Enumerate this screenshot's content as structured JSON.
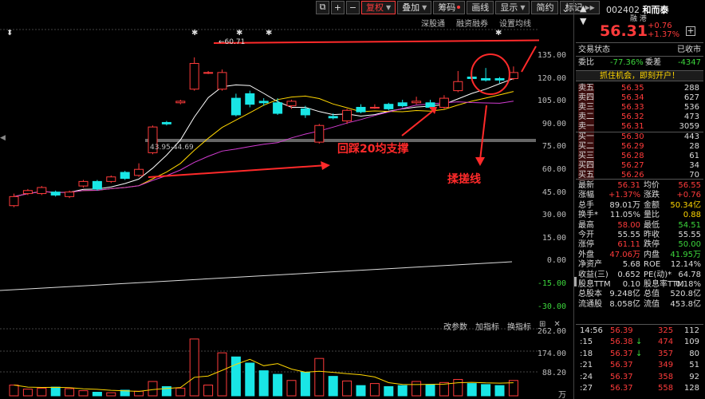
{
  "toolbar": {
    "fuquan": "复权",
    "diejia": "叠加",
    "chouma": "筹码",
    "huaxian": "画线",
    "xianshi": "显示",
    "jianyue": "简约",
    "jiliang": "标记"
  },
  "subtabs": [
    "深股通",
    "融资融券",
    "设置均线"
  ],
  "chart_data": {
    "type": "candlestick",
    "y_ticks": [
      "135.00",
      "120.00",
      "105.00",
      "90.00",
      "75.00",
      "60.00",
      "45.00",
      "30.00",
      "15.00",
      "0.00",
      "-15.00",
      "-30.00"
    ],
    "peak_label": "60.71",
    "range_label": "43.95-44.69",
    "candles": [
      {
        "o": 36,
        "c": 42,
        "h": 44,
        "l": 35
      },
      {
        "o": 44,
        "c": 46,
        "h": 47,
        "l": 43
      },
      {
        "o": 44,
        "c": 48,
        "h": 49,
        "l": 43
      },
      {
        "o": 45,
        "c": 43,
        "h": 46,
        "l": 42
      },
      {
        "o": 42,
        "c": 45,
        "h": 46,
        "l": 41
      },
      {
        "o": 49,
        "c": 52,
        "h": 53,
        "l": 48
      },
      {
        "o": 52,
        "c": 47,
        "h": 53,
        "l": 46
      },
      {
        "o": 52,
        "c": 55,
        "h": 56,
        "l": 51
      },
      {
        "o": 58,
        "c": 54,
        "h": 59,
        "l": 53
      },
      {
        "o": 56,
        "c": 60,
        "h": 64,
        "l": 55
      },
      {
        "o": 71,
        "c": 88,
        "h": 89,
        "l": 70
      },
      {
        "o": 91,
        "c": 90,
        "h": 92,
        "l": 89
      },
      {
        "o": 104,
        "c": 105,
        "h": 106,
        "l": 103
      },
      {
        "o": 113,
        "c": 130,
        "h": 134,
        "l": 112
      },
      {
        "o": 124,
        "c": 124,
        "h": 125,
        "l": 123
      },
      {
        "o": 113,
        "c": 124,
        "h": 126,
        "l": 112
      },
      {
        "o": 107,
        "c": 96,
        "h": 110,
        "l": 95
      },
      {
        "o": 110,
        "c": 103,
        "h": 112,
        "l": 101
      },
      {
        "o": 105,
        "c": 104,
        "h": 107,
        "l": 102
      },
      {
        "o": 104,
        "c": 97,
        "h": 107,
        "l": 96
      },
      {
        "o": 102,
        "c": 105,
        "h": 106,
        "l": 100
      },
      {
        "o": 100,
        "c": 96,
        "h": 102,
        "l": 94
      },
      {
        "o": 78,
        "c": 89,
        "h": 90,
        "l": 77
      },
      {
        "o": 95,
        "c": 94,
        "h": 97,
        "l": 93
      },
      {
        "o": 92,
        "c": 99,
        "h": 100,
        "l": 90
      },
      {
        "o": 101,
        "c": 98,
        "h": 103,
        "l": 97
      },
      {
        "o": 101,
        "c": 101,
        "h": 103,
        "l": 100
      },
      {
        "o": 103,
        "c": 100,
        "h": 104,
        "l": 99
      },
      {
        "o": 104,
        "c": 102,
        "h": 106,
        "l": 101
      },
      {
        "o": 104,
        "c": 105,
        "h": 108,
        "l": 103
      },
      {
        "o": 104,
        "c": 101,
        "h": 106,
        "l": 100
      },
      {
        "o": 101,
        "c": 107,
        "h": 109,
        "l": 100
      },
      {
        "o": 112,
        "c": 118,
        "h": 125,
        "l": 111
      },
      {
        "o": 121,
        "c": 120,
        "h": 126,
        "l": 119
      },
      {
        "o": 120,
        "c": 119,
        "h": 127,
        "l": 118
      },
      {
        "o": 120,
        "c": 119,
        "h": 121,
        "l": 117
      },
      {
        "o": 120,
        "c": 124,
        "h": 128,
        "l": 119
      }
    ],
    "volumes": [
      42,
      26,
      30,
      34,
      28,
      20,
      14,
      12,
      22,
      18,
      56,
      36,
      30,
      222,
      42,
      168,
      152,
      128,
      98,
      84,
      60,
      92,
      146,
      76,
      58,
      40,
      48,
      36,
      40,
      56,
      44,
      52,
      64,
      48,
      44,
      40,
      60
    ],
    "vol_ticks": [
      "262.00",
      "174.00",
      "88.20",
      "万"
    ]
  },
  "annotations": {
    "support": "回踩20均支撑",
    "rub": "揉搓线"
  },
  "indicator_bar": [
    "改参数",
    "加指标",
    "换指标"
  ],
  "quote": {
    "code": "002402",
    "name": "和而泰",
    "tags": "融 港",
    "price": "56.31",
    "change": "+0.76",
    "change_pct": "+1.37%",
    "status_label": "交易状态",
    "status": "已收市",
    "weibi_label": "委比",
    "weibi": "-77.36%",
    "weicha_label": "委差",
    "weicha": "-4347",
    "promo": "抓住机会，即刻开户！",
    "asks": [
      {
        "label": "卖五",
        "price": "56.35",
        "vol": "288"
      },
      {
        "label": "卖四",
        "price": "56.34",
        "vol": "627"
      },
      {
        "label": "卖三",
        "price": "56.33",
        "vol": "536"
      },
      {
        "label": "卖二",
        "price": "56.32",
        "vol": "473"
      },
      {
        "label": "卖一",
        "price": "56.31",
        "vol": "3059"
      }
    ],
    "bids": [
      {
        "label": "买一",
        "price": "56.30",
        "vol": "443"
      },
      {
        "label": "买二",
        "price": "56.29",
        "vol": "28"
      },
      {
        "label": "买三",
        "price": "56.28",
        "vol": "61"
      },
      {
        "label": "买四",
        "price": "56.27",
        "vol": "34"
      },
      {
        "label": "买五",
        "price": "56.26",
        "vol": "70"
      }
    ],
    "stats": [
      {
        "l1": "最新",
        "v1": "56.31",
        "c1": "red",
        "l2": "均价",
        "v2": "56.55",
        "c2": "red"
      },
      {
        "l1": "涨幅",
        "v1": "+1.37%",
        "c1": "red",
        "l2": "涨跌",
        "v2": "+0.76",
        "c2": "red"
      },
      {
        "l1": "总手",
        "v1": "89.01万",
        "c1": "white",
        "l2": "金额",
        "v2": "50.34亿",
        "c2": "yellow"
      },
      {
        "l1": "换手*",
        "v1": "11.05%",
        "c1": "white",
        "l2": "量比",
        "v2": "0.88",
        "c2": "yellow"
      },
      {
        "l1": "最高",
        "v1": "58.00",
        "c1": "red",
        "l2": "最低",
        "v2": "54.51",
        "c2": "green"
      },
      {
        "l1": "今开",
        "v1": "55.55",
        "c1": "white",
        "l2": "昨收",
        "v2": "55.55",
        "c2": "white"
      },
      {
        "l1": "涨停",
        "v1": "61.11",
        "c1": "red",
        "l2": "跌停",
        "v2": "50.00",
        "c2": "green"
      },
      {
        "l1": "外盘",
        "v1": "47.06万",
        "c1": "red",
        "l2": "内盘",
        "v2": "41.95万",
        "c2": "green"
      },
      {
        "l1": "净资产",
        "v1": "5.68",
        "c1": "white",
        "l2": "ROE",
        "v2": "12.14%",
        "c2": "white"
      },
      {
        "l1": "收益(三)",
        "v1": "0.652",
        "c1": "white",
        "l2": "PE(动)*",
        "v2": "64.78",
        "c2": "white"
      },
      {
        "l1": "股息TTM",
        "v1": "0.10",
        "c1": "white",
        "l2": "股息率TTM",
        "v2": "0.18%",
        "c2": "white"
      },
      {
        "l1": "总股本",
        "v1": "9.248亿",
        "c1": "white",
        "l2": "总值",
        "v2": "520.8亿",
        "c2": "white"
      },
      {
        "l1": "流通股",
        "v1": "8.058亿",
        "c1": "white",
        "l2": "流值",
        "v2": "453.8亿",
        "c2": "white"
      }
    ],
    "ticks": [
      {
        "t": "14:56",
        "p": "56.39",
        "v": "325",
        "n": "112",
        "arrow": ""
      },
      {
        "t": ":15",
        "p": "56.38",
        "v": "474",
        "n": "109",
        "arrow": "↓"
      },
      {
        "t": ":18",
        "p": "56.37",
        "v": "357",
        "n": "80",
        "arrow": "↓"
      },
      {
        "t": ":21",
        "p": "56.37",
        "v": "349",
        "n": "51",
        "arrow": ""
      },
      {
        "t": ":24",
        "p": "56.37",
        "v": "358",
        "n": "92",
        "arrow": ""
      },
      {
        "t": ":27",
        "p": "56.37",
        "v": "558",
        "n": "128",
        "arrow": ""
      }
    ]
  }
}
